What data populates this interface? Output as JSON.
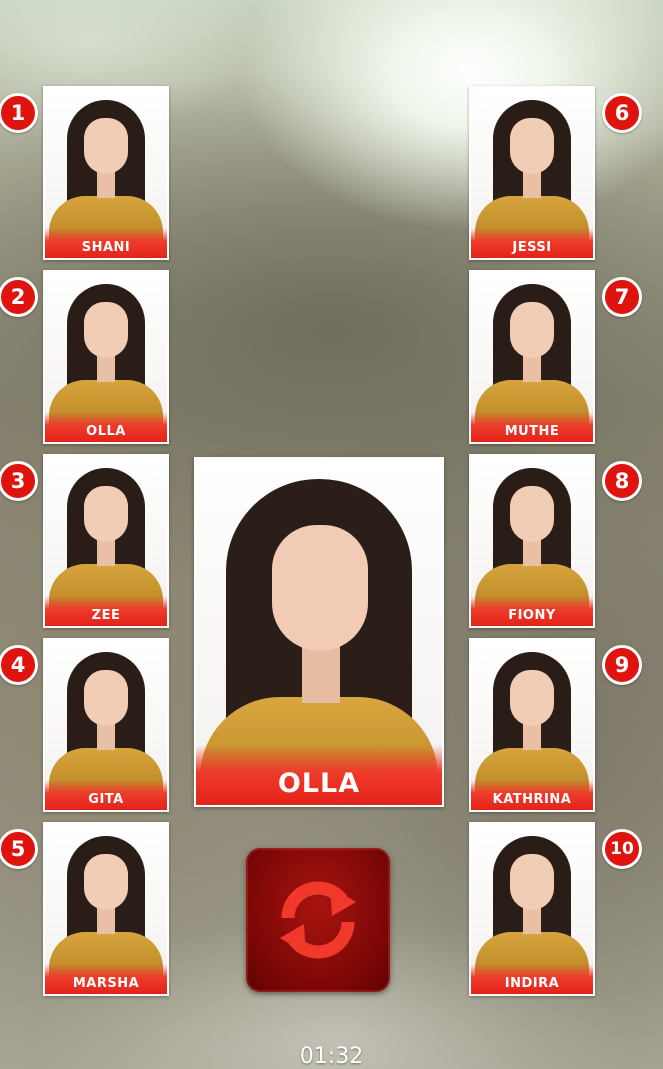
{
  "members": [
    {
      "rank": "1",
      "name": "SHANI"
    },
    {
      "rank": "2",
      "name": "OLLA"
    },
    {
      "rank": "3",
      "name": "ZEE"
    },
    {
      "rank": "4",
      "name": "GITA"
    },
    {
      "rank": "5",
      "name": "MARSHA"
    },
    {
      "rank": "6",
      "name": "JESSI"
    },
    {
      "rank": "7",
      "name": "MUTHE"
    },
    {
      "rank": "8",
      "name": "FIONY"
    },
    {
      "rank": "9",
      "name": "KATHRINA"
    },
    {
      "rank": "10",
      "name": "INDIRA"
    }
  ],
  "current": {
    "name": "OLLA"
  },
  "refresh_button": {
    "icon": "refresh-icon"
  },
  "timer": "01:32",
  "colors": {
    "badge": "#e0140f",
    "nameplate": "#e4231a",
    "refresh_button": "#7a0706",
    "refresh_arrows": "#f0392b"
  }
}
